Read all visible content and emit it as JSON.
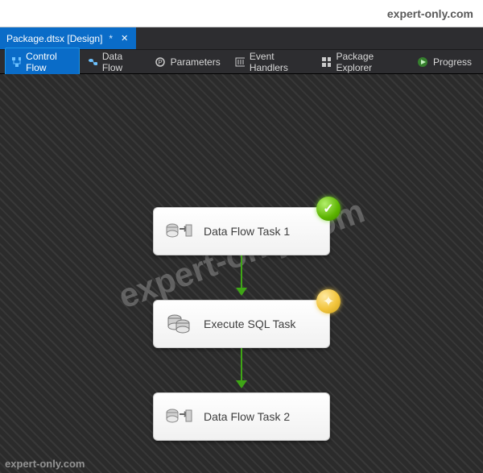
{
  "header": {
    "site": "expert-only.com"
  },
  "document_tab": {
    "label": "Package.dtsx [Design]",
    "modified_mark": "*"
  },
  "toolbar": {
    "items": [
      {
        "label": "Control Flow"
      },
      {
        "label": "Data Flow"
      },
      {
        "label": "Parameters"
      },
      {
        "label": "Event Handlers"
      },
      {
        "label": "Package Explorer"
      },
      {
        "label": "Progress"
      }
    ]
  },
  "canvas": {
    "watermark": "expert-only.com",
    "watermark_corner": "expert-only.com",
    "tasks": [
      {
        "label": "Data Flow Task 1"
      },
      {
        "label": "Execute SQL Task"
      },
      {
        "label": "Data Flow Task 2"
      }
    ]
  }
}
